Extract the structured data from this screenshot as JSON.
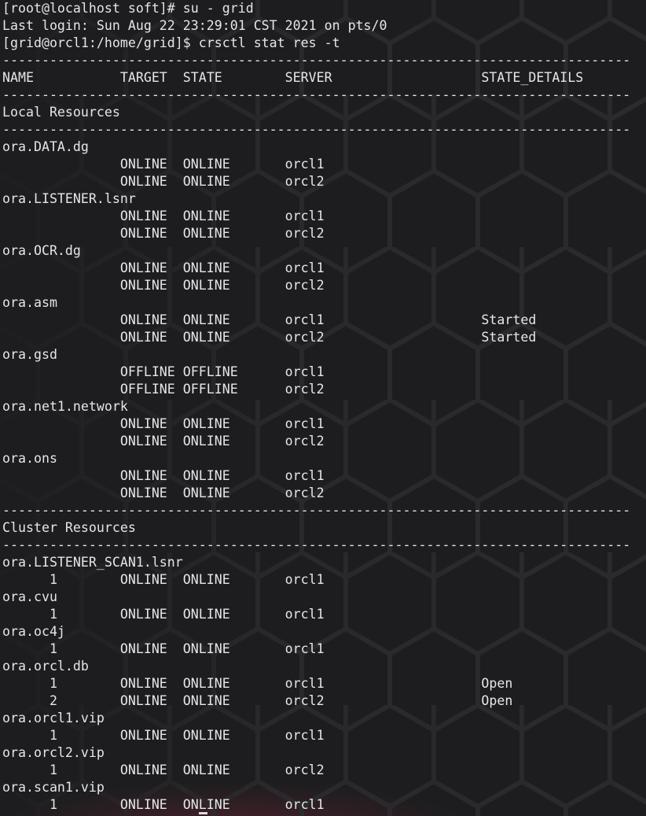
{
  "terminal": {
    "lines": [
      "[root@localhost soft]# su - grid",
      "Last login: Sun Aug 22 23:29:01 CST 2021 on pts/0",
      "[grid@orcl1:/home/grid]$ crsctl stat res -t",
      "--------------------------------------------------------------------------------",
      "NAME           TARGET  STATE        SERVER                   STATE_DETAILS",
      "--------------------------------------------------------------------------------",
      "Local Resources",
      "--------------------------------------------------------------------------------",
      "ora.DATA.dg",
      "               ONLINE  ONLINE       orcl1",
      "               ONLINE  ONLINE       orcl2",
      "ora.LISTENER.lsnr",
      "               ONLINE  ONLINE       orcl1",
      "               ONLINE  ONLINE       orcl2",
      "ora.OCR.dg",
      "               ONLINE  ONLINE       orcl1",
      "               ONLINE  ONLINE       orcl2",
      "ora.asm",
      "               ONLINE  ONLINE       orcl1                    Started",
      "               ONLINE  ONLINE       orcl2                    Started",
      "ora.gsd",
      "               OFFLINE OFFLINE      orcl1",
      "               OFFLINE OFFLINE      orcl2",
      "ora.net1.network",
      "               ONLINE  ONLINE       orcl1",
      "               ONLINE  ONLINE       orcl2",
      "ora.ons",
      "               ONLINE  ONLINE       orcl1",
      "               ONLINE  ONLINE       orcl2",
      "--------------------------------------------------------------------------------",
      "Cluster Resources",
      "--------------------------------------------------------------------------------",
      "ora.LISTENER_SCAN1.lsnr",
      "      1        ONLINE  ONLINE       orcl1",
      "ora.cvu",
      "      1        ONLINE  ONLINE       orcl1",
      "ora.oc4j",
      "      1        ONLINE  ONLINE       orcl1",
      "ora.orcl.db",
      "      1        ONLINE  ONLINE       orcl1                    Open",
      "      2        ONLINE  ONLINE       orcl2                    Open",
      "ora.orcl1.vip",
      "      1        ONLINE  ONLINE       orcl1",
      "ora.orcl2.vip",
      "      1        ONLINE  ONLINE       orcl2",
      "ora.scan1.vip",
      "      1        ONLINE  ONLINE       orcl1"
    ]
  },
  "colors": {
    "background": "#1d1d1f",
    "text": "#e6e6e6",
    "hex_pattern": "#2b2b2e",
    "glow": "#8c283c"
  }
}
